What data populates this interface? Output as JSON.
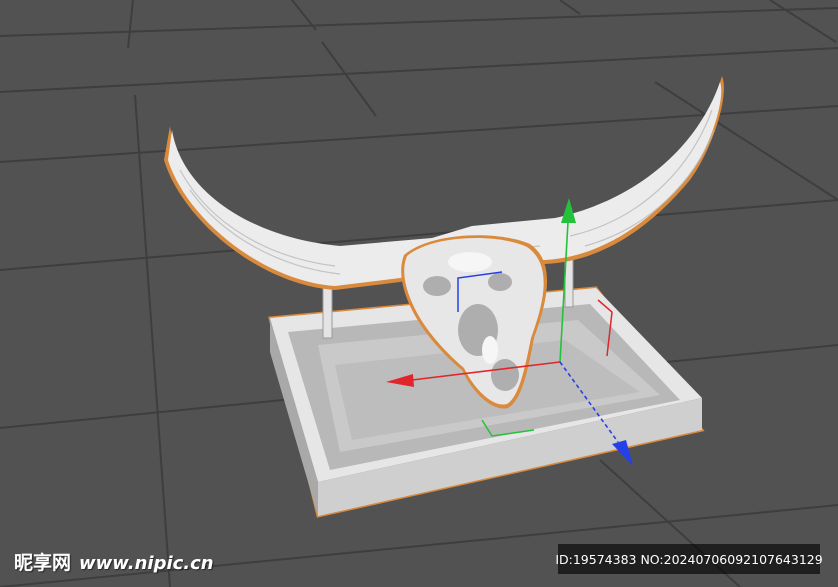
{
  "viewport": {
    "background": "#525252",
    "grid_color": "#3f3f3f",
    "selection_outline": "#d98a3c",
    "axis_colors": {
      "x": "#e0262a",
      "y": "#23c23a",
      "z": "#2540e6"
    }
  },
  "scene": {
    "object": "bull-skull-on-stand",
    "icons": [
      "move-gizmo-x-arrow",
      "move-gizmo-y-arrow",
      "move-gizmo-z-arrow"
    ]
  },
  "watermark": {
    "brand": "昵享网",
    "url": "www.nipic.cn",
    "id_text": "ID:19574383 NO:20240706092107643129"
  }
}
